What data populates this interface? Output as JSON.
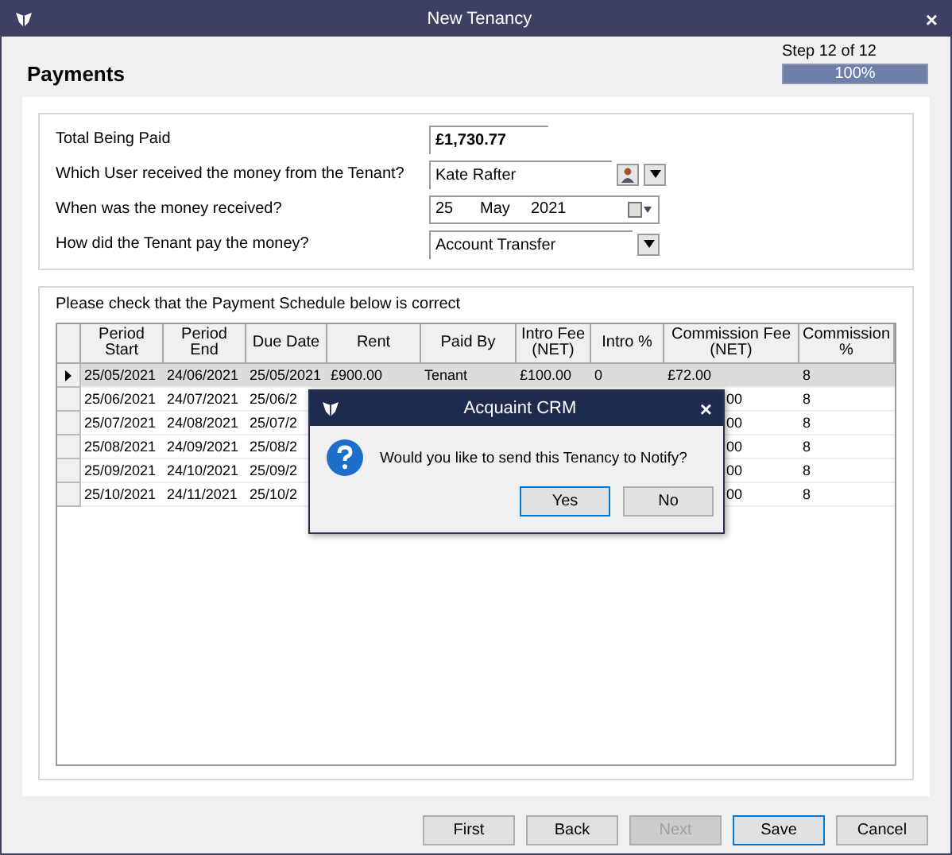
{
  "window": {
    "title": "New Tenancy"
  },
  "header": {
    "title": "Payments",
    "step": "Step 12 of 12",
    "progress": {
      "level": 1,
      "label": "100%"
    }
  },
  "form": [
    {
      "kind": "text",
      "label": "Total Being Paid",
      "value": "£1,730.77"
    },
    {
      "kind": "user",
      "label": "Which User received the money from the Tenant?",
      "value": "Kate Rafter"
    },
    {
      "kind": "date",
      "label": "When was the money received?",
      "day": "25",
      "month": "May",
      "year": "2021"
    },
    {
      "kind": "select",
      "label": "How did the Tenant pay the money?",
      "value": "Account Transfer"
    }
  ],
  "schedule": {
    "caption": "Please check that the Payment Schedule below is correct",
    "columns": [
      "Period Start",
      "Period End",
      "Due Date",
      "Rent",
      "Paid By",
      "Intro Fee (NET)",
      "Intro %",
      "Commission Fee (NET)",
      "Commission %"
    ],
    "rows": [
      {
        "selected": true,
        "cells": [
          "25/05/2021",
          "24/06/2021",
          "25/05/2021",
          "£900.00",
          "Tenant",
          "£100.00",
          "0",
          "£72.00",
          "8"
        ]
      },
      {
        "selected": false,
        "cells": [
          "25/06/2021",
          "24/07/2021",
          "25/06/2",
          null,
          null,
          null,
          null,
          "00",
          "8"
        ]
      },
      {
        "selected": false,
        "cells": [
          "25/07/2021",
          "24/08/2021",
          "25/07/2",
          null,
          null,
          null,
          null,
          "00",
          "8"
        ]
      },
      {
        "selected": false,
        "cells": [
          "25/08/2021",
          "24/09/2021",
          "25/08/2",
          null,
          null,
          null,
          null,
          "00",
          "8"
        ]
      },
      {
        "selected": false,
        "cells": [
          "25/09/2021",
          "24/10/2021",
          "25/09/2",
          null,
          null,
          null,
          null,
          "00",
          "8"
        ]
      },
      {
        "selected": false,
        "cells": [
          "25/10/2021",
          "24/11/2021",
          "25/10/2",
          null,
          null,
          null,
          null,
          "00",
          "8"
        ]
      }
    ]
  },
  "dialog": {
    "title": "Acquaint CRM",
    "close": "×",
    "message": "Would you like to send this Tenancy to Notify?",
    "buttons": [
      {
        "label": "Yes",
        "default": true
      },
      {
        "label": "No",
        "default": false
      }
    ]
  },
  "buttons": [
    {
      "label": "First",
      "disabled": false,
      "default": false
    },
    {
      "label": "Back",
      "disabled": false,
      "default": false
    },
    {
      "label": "Next",
      "disabled": true,
      "default": false
    },
    {
      "label": "Save",
      "disabled": false,
      "default": true
    },
    {
      "label": "Cancel",
      "disabled": false,
      "default": false
    }
  ],
  "close": "×"
}
